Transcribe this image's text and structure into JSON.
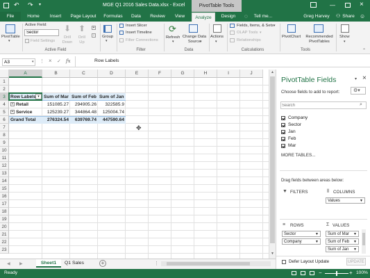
{
  "window": {
    "title": "MGE Q1 2016 Sales Data.xlsx - Excel",
    "context_tab": "PivotTable Tools",
    "user": "Greg Harvey",
    "share": "Share",
    "tellme": "Tell me..."
  },
  "tabs": [
    "File",
    "Home",
    "Insert",
    "Page Layout",
    "Formulas",
    "Data",
    "Review",
    "View",
    "Analyze",
    "Design"
  ],
  "ribbon": {
    "pivottable": "PivotTable",
    "active_field_label": "Active Field:",
    "active_field_value": "Sector",
    "field_settings": "Field Settings",
    "drill_down": "Drill Down",
    "drill_up": "Drill Up",
    "group_active_field": "Active Field",
    "group": "Group",
    "insert_slicer": "Insert Slicer",
    "insert_timeline": "Insert Timeline",
    "filter_connections": "Filter Connections",
    "group_filter": "Filter",
    "refresh": "Refresh",
    "change_data_source": "Change Data Source",
    "group_data": "Data",
    "actions": "Actions",
    "fields_items_sets": "Fields, Items, & Sets",
    "olap_tools": "OLAP Tools",
    "relationships": "Relationships",
    "group_calculations": "Calculations",
    "pivotchart": "PivotChart",
    "recommended_pivottables": "Recommended PivotTables",
    "group_tools": "Tools",
    "show": "Show"
  },
  "formula_bar": {
    "name_box": "A3",
    "fx": "fx",
    "content": "Row Labels"
  },
  "columns": [
    "A",
    "B",
    "C",
    "D",
    "E",
    "F",
    "G",
    "H",
    "I",
    "J"
  ],
  "rows": [
    "1",
    "2",
    "3",
    "4",
    "5",
    "6",
    "7",
    "8",
    "9",
    "10",
    "11",
    "12",
    "13",
    "14",
    "15",
    "16",
    "17",
    "18",
    "19",
    "20",
    "21",
    "22",
    "23"
  ],
  "pivot": {
    "header": [
      "Row Labels",
      "Sum of Mar",
      "Sum of Feb",
      "Sum of Jan"
    ],
    "rows": [
      {
        "label": "Retail",
        "values": [
          "151085.27",
          "294905.26",
          "322585.9"
        ]
      },
      {
        "label": "Service",
        "values": [
          "125239.27",
          "344864.48",
          "125004.74"
        ]
      }
    ],
    "total": {
      "label": "Grand Total",
      "values": [
        "276324.54",
        "639769.74",
        "447590.64"
      ]
    }
  },
  "sheet_tabs": [
    "Sheet1",
    "Q1 Sales"
  ],
  "status": {
    "ready": "Ready",
    "zoom": "100%"
  },
  "panel": {
    "title": "PivotTable Fields",
    "choose": "Choose fields to add to report:",
    "search_placeholder": "Search",
    "fields": [
      "Company",
      "Sector",
      "Jan",
      "Feb",
      "Mar"
    ],
    "more_tables": "MORE TABLES...",
    "drag_text": "Drag fields between areas below:",
    "filters": "FILTERS",
    "columns": "COLUMNS",
    "rows": "ROWS",
    "values": "VALUES",
    "columns_items": [
      "Values"
    ],
    "rows_items": [
      "Sector",
      "Company"
    ],
    "values_items": [
      "Sum of Mar",
      "Sum of Feb",
      "Sum of Jan"
    ],
    "defer": "Defer Layout Update",
    "update": "UPDATE"
  },
  "colors": {
    "excel_green": "#217346",
    "header_fill": "#ddebf7"
  }
}
